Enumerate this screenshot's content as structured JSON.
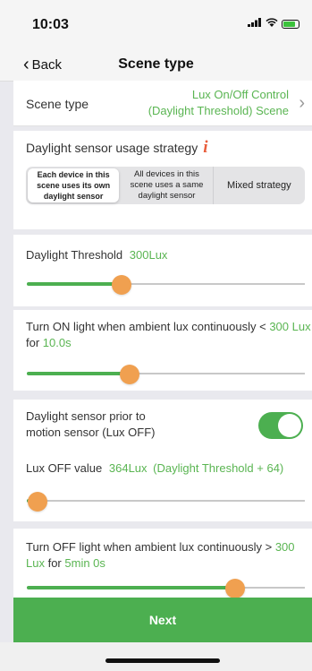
{
  "status": {
    "time": "10:03"
  },
  "nav": {
    "back_label": "Back",
    "title": "Scene type"
  },
  "scene_type": {
    "label": "Scene type",
    "value_line1": "Lux On/Off Control",
    "value_line2": "(Daylight Threshold) Scene"
  },
  "strategy": {
    "title": "Daylight sensor usage strategy",
    "options": [
      {
        "line1": "Each device in this",
        "line2": "scene uses its own",
        "line3": "daylight sensor"
      },
      {
        "line1": "All devices in this",
        "line2": "scene uses a same",
        "line3": "daylight sensor"
      },
      {
        "line1": "Mixed strategy"
      }
    ],
    "selected_index": 0
  },
  "threshold": {
    "label": "Daylight Threshold",
    "value": "300Lux",
    "slider_fraction": 0.34
  },
  "turn_on": {
    "text_prefix": "Turn ON light when ambient lux continuously <",
    "lux": "300",
    "lux_unit": "Lux",
    "for_word": "for",
    "duration": "10.0s",
    "slider_fraction": 0.37
  },
  "prior": {
    "line1": "Daylight sensor prior to",
    "line2": "motion sensor (Lux OFF)",
    "toggle_on": true
  },
  "lux_off": {
    "label": "Lux OFF value",
    "value": "364Lux",
    "note": "(Daylight Threshold + 64)",
    "slider_fraction": 0.04
  },
  "turn_off": {
    "text_prefix": "Turn OFF light when ambient lux continuously >",
    "lux_value": "300 Lux",
    "for_word": "for",
    "duration": "5min 0s",
    "slider_fraction": 0.75
  },
  "footer": {
    "next_label": "Next"
  }
}
